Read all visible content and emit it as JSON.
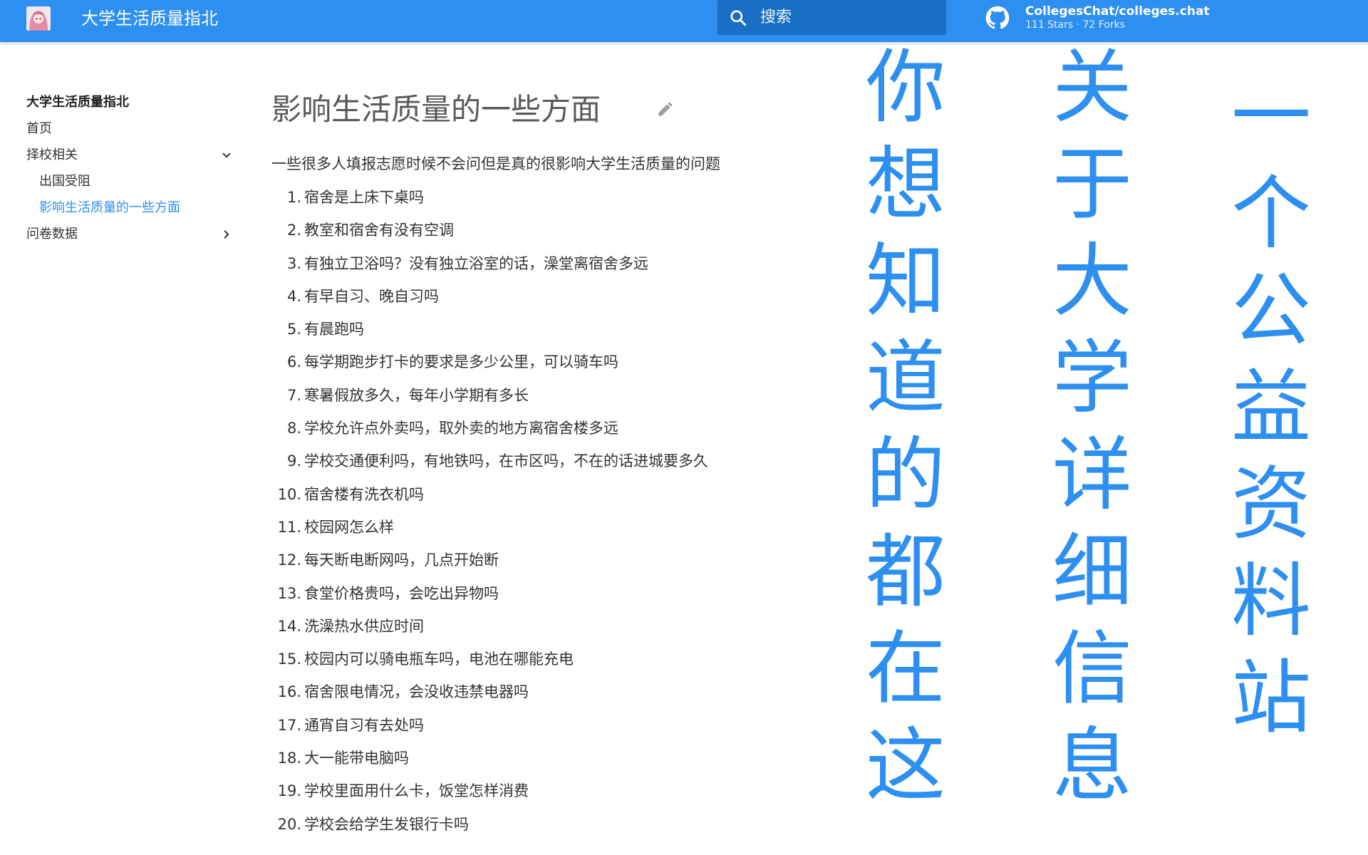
{
  "header": {
    "title": "大学生活质量指北",
    "search_placeholder": "搜索",
    "repo_name": "CollegesChat/colleges.chat",
    "repo_stats": "111 Stars · 72 Forks"
  },
  "sidebar": {
    "title": "大学生活质量指北",
    "items": [
      {
        "label": "首页"
      },
      {
        "label": "择校相关",
        "chevron": "chevron-down-icon"
      },
      {
        "label": "出国受阻"
      },
      {
        "label": "影响生活质量的一些方面"
      },
      {
        "label": "问卷数据",
        "chevron": "chevron-right-icon"
      }
    ]
  },
  "main": {
    "title": "影响生活质量的一些方面",
    "intro": "一些很多人填报志愿时候不会问但是真的很影响大学生活质量的问题",
    "questions": [
      {
        "num": "1.",
        "text": "宿舍是上床下桌吗"
      },
      {
        "num": "2.",
        "text": "教室和宿舍有没有空调"
      },
      {
        "num": "3.",
        "text": "有独立卫浴吗？没有独立浴室的话，澡堂离宿舍多远"
      },
      {
        "num": "4.",
        "text": "有早自习、晚自习吗"
      },
      {
        "num": "5.",
        "text": "有晨跑吗"
      },
      {
        "num": "6.",
        "text": "每学期跑步打卡的要求是多少公里，可以骑车吗"
      },
      {
        "num": "7.",
        "text": "寒暑假放多久，每年小学期有多长"
      },
      {
        "num": "8.",
        "text": "学校允许点外卖吗，取外卖的地方离宿舍楼多远"
      },
      {
        "num": "9.",
        "text": "学校交通便利吗，有地铁吗，在市区吗，不在的话进城要多久"
      },
      {
        "num": "10.",
        "text": "宿舍楼有洗衣机吗"
      },
      {
        "num": "11.",
        "text": "校园网怎么样"
      },
      {
        "num": "12.",
        "text": "每天断电断网吗，几点开始断"
      },
      {
        "num": "13.",
        "text": "食堂价格贵吗，会吃出异物吗"
      },
      {
        "num": "14.",
        "text": "洗澡热水供应时间"
      },
      {
        "num": "15.",
        "text": "校园内可以骑电瓶车吗，电池在哪能充电"
      },
      {
        "num": "16.",
        "text": "宿舍限电情况，会没收违禁电器吗"
      },
      {
        "num": "17.",
        "text": "通宵自习有去处吗"
      },
      {
        "num": "18.",
        "text": "大一能带电脑吗"
      },
      {
        "num": "19.",
        "text": "学校里面用什么卡，饭堂怎样消费"
      },
      {
        "num": "20.",
        "text": "学校会给学生发银行卡吗"
      }
    ]
  },
  "overlay": {
    "col1": [
      "你",
      "想",
      "知",
      "道",
      "的",
      "都",
      "在",
      "这"
    ],
    "col2": [
      "关",
      "于",
      "大",
      "学",
      "详",
      "细",
      "信",
      "息"
    ],
    "col3": [
      "一",
      "个",
      "公",
      "益",
      "资",
      "料",
      "站"
    ]
  },
  "colors": {
    "primary": "#2d8ff0",
    "search_bg": "#1a6fc4",
    "text": "#333333",
    "title": "#5a5a5a"
  }
}
